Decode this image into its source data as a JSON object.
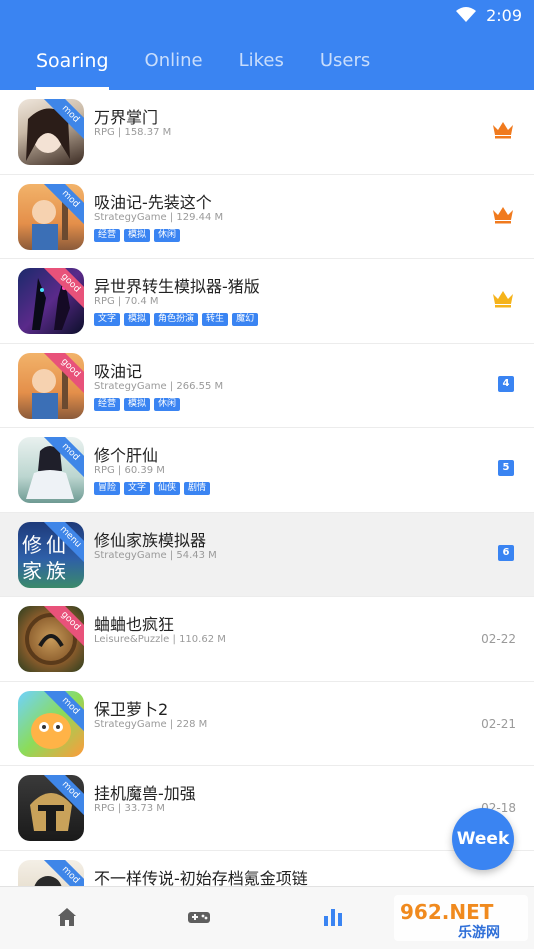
{
  "status_bar": {
    "time": "2:09"
  },
  "tabs": [
    {
      "label": "Soaring",
      "active": true
    },
    {
      "label": "Online",
      "active": false
    },
    {
      "label": "Likes",
      "active": false
    },
    {
      "label": "Users",
      "active": false
    }
  ],
  "apps": [
    {
      "title": "万界掌门",
      "meta": "RPG | 158.37 M",
      "badge": "mod",
      "tags": [],
      "rank_icon": "crown-orange-icon",
      "rank": ""
    },
    {
      "title": "吸油记-先装这个",
      "meta": "StrategyGame | 129.44 M",
      "badge": "mod",
      "tags": [
        "经营",
        "模拟",
        "休闲"
      ],
      "rank_icon": "crown-orange-icon",
      "rank": ""
    },
    {
      "title": "异世界转生模拟器-猪版",
      "meta": "RPG | 70.4 M",
      "badge": "good",
      "tags": [
        "文字",
        "模拟",
        "角色扮演",
        "转生",
        "魔幻"
      ],
      "rank_icon": "crown-gold-icon",
      "rank": ""
    },
    {
      "title": "吸油记",
      "meta": "StrategyGame | 266.55 M",
      "badge": "good",
      "tags": [
        "经营",
        "模拟",
        "休闲"
      ],
      "rank_icon": "",
      "rank": "4"
    },
    {
      "title": "修个肝仙",
      "meta": "RPG | 60.39 M",
      "badge": "mod",
      "tags": [
        "冒险",
        "文字",
        "仙侠",
        "剧情"
      ],
      "rank_icon": "",
      "rank": "5"
    },
    {
      "title": "修仙家族模拟器",
      "meta": "StrategyGame | 54.43 M",
      "badge": "menu",
      "tags": [],
      "rank_icon": "",
      "rank": "6"
    },
    {
      "title": "蛐蛐也疯狂",
      "meta": "Leisure&Puzzle | 110.62 M",
      "badge": "good",
      "tags": [],
      "rank_icon": "",
      "rank": "",
      "date": "02-22"
    },
    {
      "title": "保卫萝卜2",
      "meta": "StrategyGame | 228 M",
      "badge": "mod",
      "tags": [],
      "rank_icon": "",
      "rank": "",
      "date": "02-21"
    },
    {
      "title": "挂机魔兽-加强",
      "meta": "RPG | 33.73 M",
      "badge": "mod",
      "tags": [],
      "rank_icon": "",
      "rank": "",
      "date": "02-18"
    },
    {
      "title": "不一样传说-初始存档氪金项链",
      "meta": "",
      "badge": "mod",
      "tags": [],
      "rank_icon": "",
      "rank": ""
    }
  ],
  "fab": {
    "label": "Week"
  },
  "bottom_nav": [
    "home-icon",
    "gamepad-icon",
    "chart-bar-icon"
  ],
  "watermark": {
    "text_top": "962.NET",
    "text_bottom": "乐游网"
  },
  "colors": {
    "primary": "#3a84f2",
    "crown_orange": "#f07a1e",
    "crown_gold": "#f5b31b",
    "ribbon_good": "#e8527a"
  }
}
